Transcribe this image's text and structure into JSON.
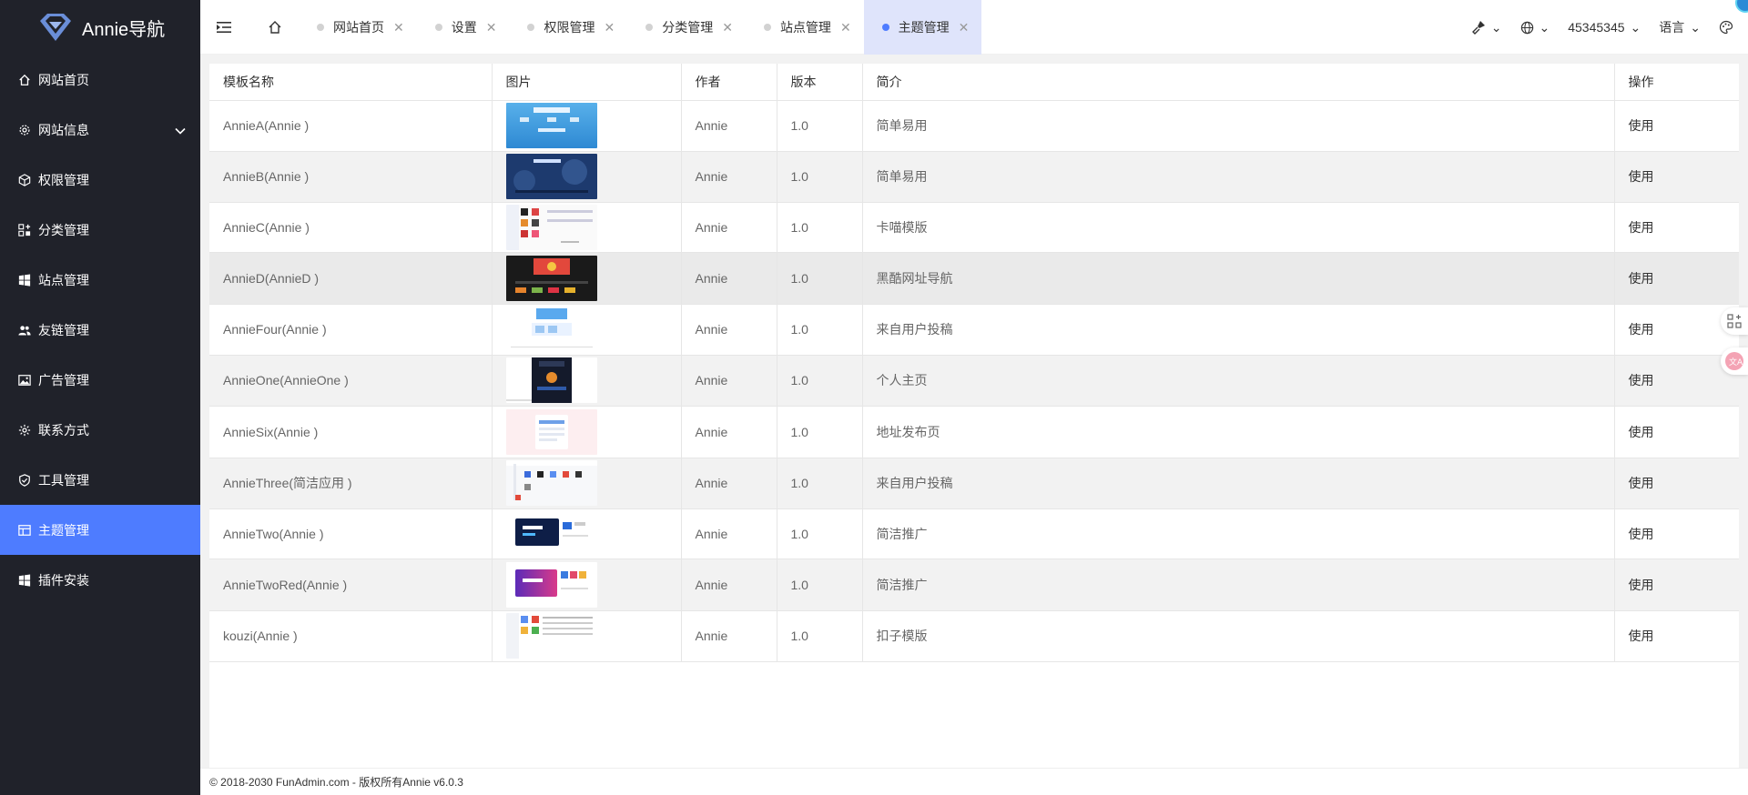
{
  "app": {
    "logo_text": "Annie导航"
  },
  "sidebar": {
    "items": [
      {
        "label": "网站首页",
        "icon": "home-icon"
      },
      {
        "label": "网站信息",
        "icon": "gear-icon",
        "expandable": true
      },
      {
        "label": "权限管理",
        "icon": "cube-icon"
      },
      {
        "label": "分类管理",
        "icon": "apps-icon"
      },
      {
        "label": "站点管理",
        "icon": "windows-icon"
      },
      {
        "label": "友链管理",
        "icon": "users-icon"
      },
      {
        "label": "广告管理",
        "icon": "image-icon"
      },
      {
        "label": "联系方式",
        "icon": "gear-small-icon"
      },
      {
        "label": "工具管理",
        "icon": "shield-icon"
      },
      {
        "label": "主题管理",
        "icon": "layout-icon",
        "active": true
      },
      {
        "label": "插件安装",
        "icon": "windows-icon"
      }
    ]
  },
  "header": {
    "tabs": [
      {
        "label": "网站首页"
      },
      {
        "label": "设置"
      },
      {
        "label": "权限管理"
      },
      {
        "label": "分类管理"
      },
      {
        "label": "站点管理"
      },
      {
        "label": "主题管理",
        "active": true
      }
    ],
    "right": {
      "user": "45345345",
      "language": "语言"
    }
  },
  "table": {
    "columns": [
      "模板名称",
      "图片",
      "作者",
      "版本",
      "简介",
      "操作"
    ],
    "rows": [
      {
        "name": "AnnieA(Annie )",
        "author": "Annie",
        "version": "1.0",
        "desc": "简单易用",
        "action": "使用",
        "thumb": "light-blue"
      },
      {
        "name": "AnnieB(Annie )",
        "author": "Annie",
        "version": "1.0",
        "desc": "简单易用",
        "action": "使用",
        "thumb": "dark-blue"
      },
      {
        "name": "AnnieC(Annie )",
        "author": "Annie",
        "version": "1.0",
        "desc": "卡喵模版",
        "action": "使用",
        "thumb": "white-grid"
      },
      {
        "name": "AnnieD(AnnieD )",
        "author": "Annie",
        "version": "1.0",
        "desc": "黑酷网址导航",
        "action": "使用",
        "thumb": "black"
      },
      {
        "name": "AnnieFour(Annie )",
        "author": "Annie",
        "version": "1.0",
        "desc": "来自用户投稿",
        "action": "使用",
        "thumb": "white-blue"
      },
      {
        "name": "AnnieOne(AnnieOne )",
        "author": "Annie",
        "version": "1.0",
        "desc": "个人主页",
        "action": "使用",
        "thumb": "dark-center"
      },
      {
        "name": "AnnieSix(Annie )",
        "author": "Annie",
        "version": "1.0",
        "desc": "地址发布页",
        "action": "使用",
        "thumb": "pink"
      },
      {
        "name": "AnnieThree(简洁应用 )",
        "author": "Annie",
        "version": "1.0",
        "desc": "来自用户投稿",
        "action": "使用",
        "thumb": "white-icons"
      },
      {
        "name": "AnnieTwo(Annie )",
        "author": "Annie",
        "version": "1.0",
        "desc": "简洁推广",
        "action": "使用",
        "thumb": "navy-card"
      },
      {
        "name": "AnnieTwoRed(Annie )",
        "author": "Annie",
        "version": "1.0",
        "desc": "简洁推广",
        "action": "使用",
        "thumb": "purple-card"
      },
      {
        "name": "kouzi(Annie )",
        "author": "Annie",
        "version": "1.0",
        "desc": "扣子模版",
        "action": "使用",
        "thumb": "white-list"
      }
    ]
  },
  "footer": {
    "text": "© 2018-2030 FunAdmin.com - 版权所有Annie v6.0.3"
  },
  "colors": {
    "sidebar_bg": "#20222a",
    "accent": "#4e7cff",
    "active_tab_bg": "#dfe4fb"
  }
}
